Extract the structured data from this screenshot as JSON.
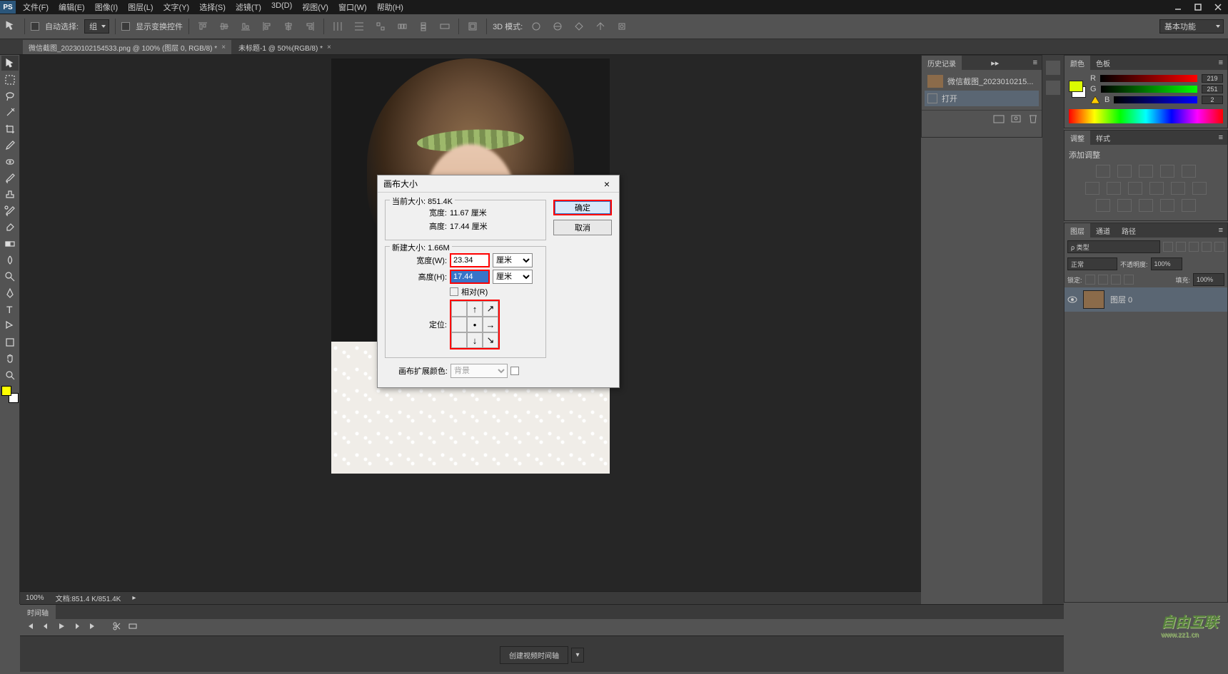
{
  "app": {
    "logo": "PS"
  },
  "menu": {
    "file": "文件(F)",
    "edit": "编辑(E)",
    "image": "图像(I)",
    "layer": "图层(L)",
    "type": "文字(Y)",
    "select": "选择(S)",
    "filter": "滤镜(T)",
    "threeD": "3D(D)",
    "view": "视图(V)",
    "window": "窗口(W)",
    "help": "帮助(H)"
  },
  "options": {
    "autoSelect": "自动选择:",
    "groupDD": "组",
    "showTransform": "显示变换控件",
    "threeDMode": "3D 模式:",
    "workspace": "基本功能"
  },
  "tabs": {
    "tab1": "微信截图_20230102154533.png @ 100% (图层 0, RGB/8) *",
    "tab2": "未标题-1 @ 50%(RGB/8) *"
  },
  "canvas": {
    "zoom": "100%",
    "docInfo": "文档:851.4 K/851.4K"
  },
  "dialog": {
    "title": "画布大小",
    "ok": "确定",
    "cancel": "取消",
    "currentSizeLabel": "当前大小: 851.4K",
    "curWidthLabel": "宽度:",
    "curWidthVal": "11.67 厘米",
    "curHeightLabel": "高度:",
    "curHeightVal": "17.44 厘米",
    "newSizeLabel": "新建大小: 1.66M",
    "widthLabel": "宽度(W):",
    "widthVal": "23.34",
    "widthUnit": "厘米",
    "heightLabel": "高度(H):",
    "heightVal": "17.44",
    "heightUnit": "厘米",
    "relative": "相对(R)",
    "anchorLabel": "定位:",
    "extensionLabel": "画布扩展颜色:",
    "extensionVal": "背景"
  },
  "panels": {
    "history": {
      "tab": "历史记录",
      "source": "微信截图_2023010215...",
      "item1": "打开"
    },
    "color": {
      "tab": "颜色",
      "swatches": "色板",
      "R": "R",
      "G": "G",
      "B": "B",
      "rval": "219",
      "gval": "251",
      "bval": "2"
    },
    "adjust": {
      "tab": "调整",
      "styles": "样式",
      "addLabel": "添加调整"
    },
    "layers": {
      "tab": "图层",
      "channels": "通道",
      "paths": "路径",
      "kindDD": "ρ 类型",
      "blendDD": "正常",
      "opacityLabel": "不透明度:",
      "opacityVal": "100%",
      "lockLabel": "锁定:",
      "fillLabel": "填充:",
      "fillVal": "100%",
      "layer0": "图层 0"
    }
  },
  "timeline": {
    "tab": "时间轴",
    "createBtn": "创建视频时间轴"
  },
  "watermark": {
    "main": "自由互联",
    "sub": "www.zz1.cn"
  }
}
